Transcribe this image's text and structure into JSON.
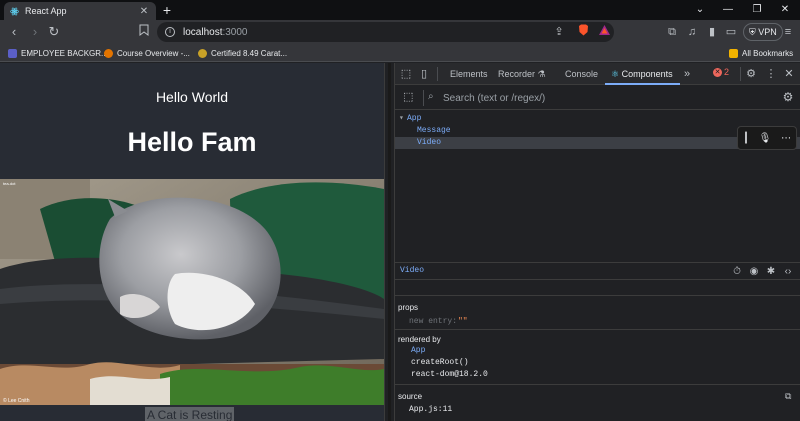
{
  "browser": {
    "tab_title": "React App",
    "new_tab": "+",
    "window_controls": [
      "chevron-down-icon",
      "minimize-icon",
      "restore-icon",
      "close-icon"
    ],
    "url_host": "localhost",
    "url_port": ":3000",
    "vpn_label": "VPN"
  },
  "bookmarks": {
    "items": [
      {
        "label": "EMPLOYEE BACKGR...",
        "icon_color": "#5b5fc7"
      },
      {
        "label": "Course Overview -...",
        "icon_color": "#e37400"
      },
      {
        "label": "Certified 8.49 Carat...",
        "icon_color": "#c9a227"
      }
    ],
    "all_bookmarks": "All Bookmarks"
  },
  "page": {
    "heading_small": "Hello World",
    "heading_large": "Hello Fam",
    "caption": "A Cat is Resting",
    "photo_credit_top": "tea-dot",
    "photo_credit_bottom": "© Lee Cnith"
  },
  "devtools": {
    "tabs": [
      "Elements",
      "Recorder",
      "Console",
      "Components"
    ],
    "active_tab": "Components",
    "error_count": "2",
    "search_placeholder": "Search (text or /regex/)",
    "tree": [
      {
        "label": "App",
        "depth": 0,
        "caret": "▾",
        "selected": false
      },
      {
        "label": "Message",
        "depth": 1,
        "caret": "",
        "selected": false
      },
      {
        "label": "Video",
        "depth": 1,
        "caret": "",
        "selected": true
      }
    ],
    "selected_component": "Video",
    "props_title": "props",
    "prop_key": "new entry:",
    "prop_value": "\"\"",
    "rendered_by_title": "rendered by",
    "rendered_by": [
      "App",
      "createRoot()",
      "react-dom@18.2.0"
    ],
    "source_title": "source",
    "source_file": "App.js:11"
  }
}
